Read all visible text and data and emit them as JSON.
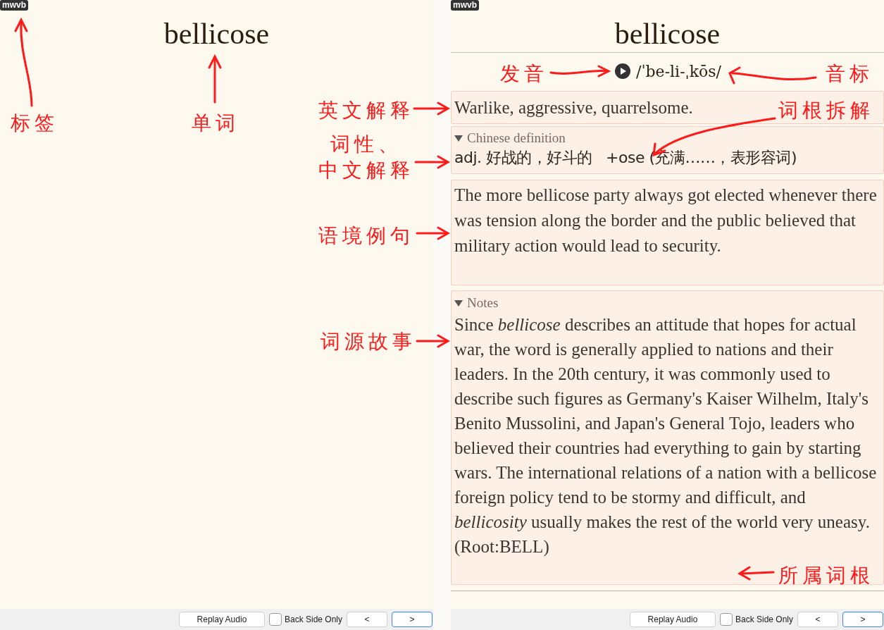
{
  "front": {
    "tag": "mwvb",
    "word": "bellicose",
    "toolbar": {
      "replay": "Replay Audio",
      "back_only": {
        "label": "Back Side Only",
        "checked": false
      },
      "nav": [
        {
          "label": "<",
          "focused": false
        },
        {
          "label": ">",
          "focused": true
        }
      ]
    }
  },
  "back": {
    "tag": "mwvb",
    "word": "bellicose",
    "pronunciation": "/ˈbe-li-ˌkōs/",
    "english_definition": "Warlike, aggressive, quarrelsome.",
    "chinese_definition": {
      "summary": "Chinese definition",
      "expanded": true,
      "text": "adj. 好战的，好斗的   +ose (充满……，表形容词)"
    },
    "example": "The more bellicose party always got elected whenever there was tension along the border and the public believed that military action would lead to security.",
    "notes": {
      "summary": "Notes",
      "expanded": true,
      "text": "Since *bellicose* describes an attitude that hopes for actual war, the word is generally applied to nations and their leaders. In the 20th century, it was commonly used to describe such figures as Germany's Kaiser Wilhelm, Italy's Benito Mussolini, and Japan's General Tojo, leaders who believed their countries had everything to gain by starting wars. The international relations of a nation with a bellicose foreign policy tend to be stormy and difficult, and *bellicosity* usually makes the rest of the world very uneasy. (Root:BELL)"
    },
    "toolbar": {
      "replay": "Replay Audio",
      "back_only": {
        "label": "Back Side Only",
        "checked": false
      },
      "nav": [
        {
          "label": "<",
          "focused": false
        },
        {
          "label": ">",
          "focused": true
        }
      ]
    }
  },
  "annotations": [
    {
      "lines": [
        "标签"
      ]
    },
    {
      "lines": [
        "单词"
      ]
    },
    {
      "lines": [
        "发音"
      ]
    },
    {
      "lines": [
        "音标"
      ]
    },
    {
      "lines": [
        "英文解释"
      ]
    },
    {
      "lines": [
        "词根拆解"
      ]
    },
    {
      "lines": [
        "词性、",
        "中文解释"
      ]
    },
    {
      "lines": [
        "语境例句"
      ]
    },
    {
      "lines": [
        "词源故事"
      ]
    },
    {
      "lines": [
        "所属词根"
      ]
    }
  ]
}
